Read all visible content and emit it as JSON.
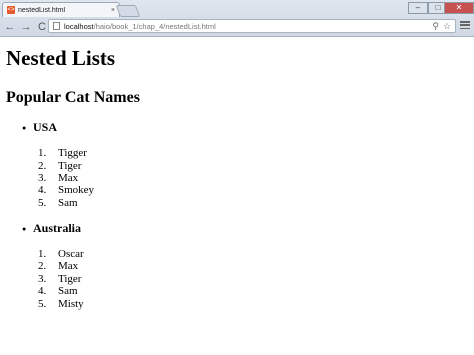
{
  "browser": {
    "tab_title": "nestedList.html",
    "tab_close": "×",
    "favicon_label": "<>",
    "url_host": "localhost",
    "url_path": "/haio/book_1/chap_4/nestedList.html",
    "back": "←",
    "forward": "→",
    "reload": "C",
    "minimize": "–",
    "maximize": "□",
    "close": "✕",
    "zoom_icon": "⚲",
    "star_icon": "☆"
  },
  "page": {
    "title": "Nested Lists",
    "subtitle": "Popular Cat Names",
    "lists": [
      {
        "country": "USA",
        "bullet": "●",
        "names": [
          {
            "num": "1.",
            "name": "Tigger"
          },
          {
            "num": "2.",
            "name": "Tiger"
          },
          {
            "num": "3.",
            "name": "Max"
          },
          {
            "num": "4.",
            "name": "Smokey"
          },
          {
            "num": "5.",
            "name": "Sam"
          }
        ]
      },
      {
        "country": "Australia",
        "bullet": "●",
        "names": [
          {
            "num": "1.",
            "name": "Oscar"
          },
          {
            "num": "2.",
            "name": "Max"
          },
          {
            "num": "3.",
            "name": "Tiger"
          },
          {
            "num": "4.",
            "name": "Sam"
          },
          {
            "num": "5.",
            "name": "Misty"
          }
        ]
      }
    ]
  }
}
